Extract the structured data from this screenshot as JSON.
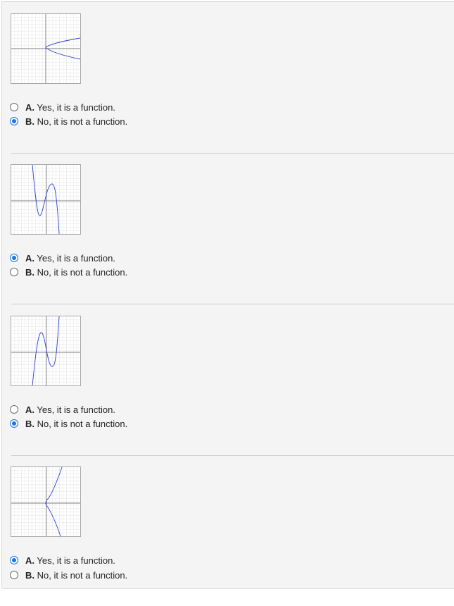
{
  "questions": [
    {
      "graph_icon": "sideways-parabola-graph",
      "options": [
        {
          "letter": "A.",
          "text": " Yes, it is a function.",
          "selected": false
        },
        {
          "letter": "B.",
          "text": " No, it is not a function.",
          "selected": true
        }
      ]
    },
    {
      "graph_icon": "cubic-curve-graph",
      "options": [
        {
          "letter": "A.",
          "text": " Yes, it is a function.",
          "selected": true
        },
        {
          "letter": "B.",
          "text": " No, it is not a function.",
          "selected": false
        }
      ]
    },
    {
      "graph_icon": "cubic-curve-graph",
      "options": [
        {
          "letter": "A.",
          "text": " Yes, it is a function.",
          "selected": false
        },
        {
          "letter": "B.",
          "text": " No, it is not a function.",
          "selected": true
        }
      ]
    },
    {
      "graph_icon": "cubic-curve-graph",
      "options": [
        {
          "letter": "A.",
          "text": " Yes, it is a function.",
          "selected": true
        },
        {
          "letter": "B.",
          "text": " No, it is not a function.",
          "selected": false
        }
      ]
    }
  ],
  "colors": {
    "accent": "#1a73e8",
    "curve": "#2b3fd6",
    "grid": "#e3e3e3",
    "axis": "#555555"
  }
}
